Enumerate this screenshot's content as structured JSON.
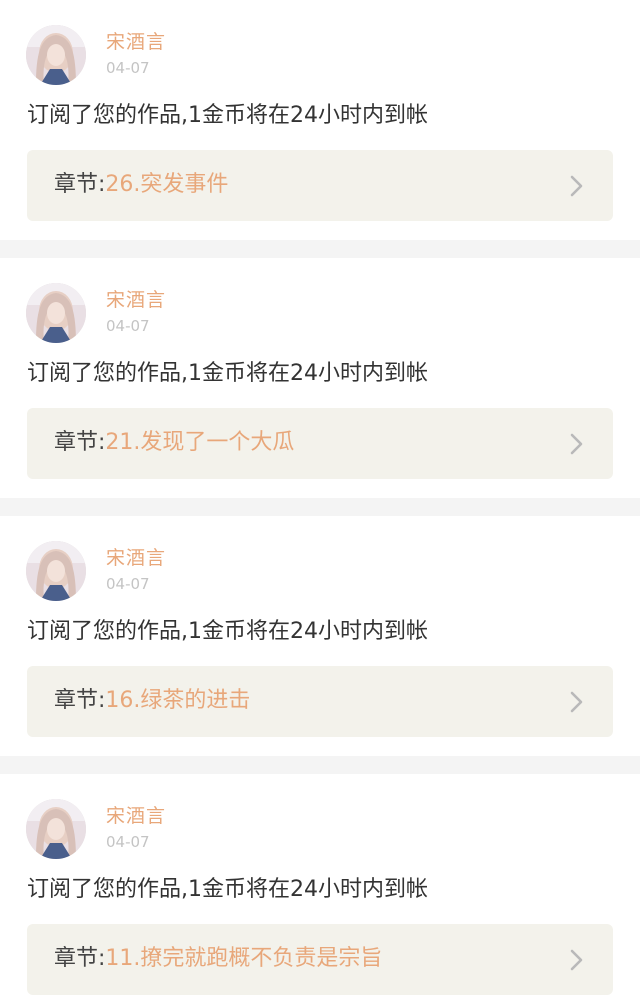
{
  "notifications": [
    {
      "username": "宋酒言",
      "date": "04-07",
      "message": "订阅了您的作品,1金币将在24小时内到帐",
      "chapter_prefix": "章节:",
      "chapter_title": "26.突发事件"
    },
    {
      "username": "宋酒言",
      "date": "04-07",
      "message": "订阅了您的作品,1金币将在24小时内到帐",
      "chapter_prefix": "章节:",
      "chapter_title": "21.发现了一个大瓜"
    },
    {
      "username": "宋酒言",
      "date": "04-07",
      "message": "订阅了您的作品,1金币将在24小时内到帐",
      "chapter_prefix": "章节:",
      "chapter_title": "16.绿茶的进击"
    },
    {
      "username": "宋酒言",
      "date": "04-07",
      "message": "订阅了您的作品,1金币将在24小时内到帐",
      "chapter_prefix": "章节:",
      "chapter_title": "11.撩完就跑概不负责是宗旨"
    }
  ],
  "icons": {
    "avatar": "user-avatar",
    "chevron": "chevron-right-icon"
  },
  "colors": {
    "accent": "#e8a77a",
    "text": "#333333",
    "muted": "#c4c4c4",
    "chapter_bg": "#f3f2eb",
    "page_bg": "#f4f4f4",
    "card_bg": "#ffffff"
  }
}
